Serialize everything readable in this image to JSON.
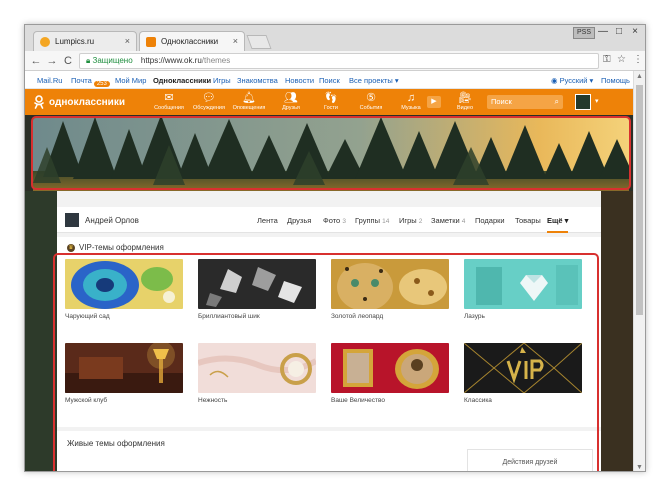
{
  "browser": {
    "tabs": [
      {
        "title": "Lumpics.ru",
        "close": "×"
      },
      {
        "title": "Одноклассники",
        "close": "×"
      }
    ],
    "user_badge": "PSS",
    "window_controls": [
      "—",
      "□",
      "×"
    ],
    "nav": {
      "back": "←",
      "forward": "→",
      "reload": "C"
    },
    "address": {
      "secure_label": "Защищено",
      "scheme_host": "https://www.ok.ru",
      "path": "/themes"
    },
    "icons": {
      "key": "⚿",
      "star": "☆",
      "menu": "⋮"
    }
  },
  "portal": {
    "links": [
      "Mail.Ru",
      "Почта",
      "Мой Мир",
      "Одноклассники",
      "Игры",
      "Знакомства",
      "Новости",
      "Поиск",
      "Все проекты ▾"
    ],
    "mail_badge": "253",
    "language": "Русский ▾",
    "help": "Помощь"
  },
  "ok_header": {
    "logo_text": "одноклассники",
    "items": [
      "Сообщения",
      "Обсуждения",
      "Оповещения",
      "Друзья",
      "Гости",
      "События",
      "Музыка",
      "Видео"
    ],
    "search_placeholder": "Поиск",
    "caret": "▾"
  },
  "profile": {
    "name": "Андрей Орлов",
    "nav": [
      {
        "label": "Лента",
        "count": ""
      },
      {
        "label": "Друзья",
        "count": ""
      },
      {
        "label": "Фото",
        "count": "3"
      },
      {
        "label": "Группы",
        "count": "14"
      },
      {
        "label": "Игры",
        "count": "2"
      },
      {
        "label": "Заметки",
        "count": "4"
      },
      {
        "label": "Подарки",
        "count": ""
      },
      {
        "label": "Товары",
        "count": ""
      },
      {
        "label": "Ещё ▾",
        "count": ""
      }
    ]
  },
  "vip": {
    "title": "VIP-темы оформления",
    "themes": [
      "Чарующий сад",
      "Бриллиантовый шик",
      "Золотой леопард",
      "Лазурь",
      "Мужской клуб",
      "Нежность",
      "Ваше Величество",
      "Классика"
    ]
  },
  "live": {
    "title": "Живые темы оформления",
    "friends_actions": "Действия друзей"
  },
  "colors": {
    "ok_orange": "#ee8208",
    "highlight": "#d8302f"
  }
}
